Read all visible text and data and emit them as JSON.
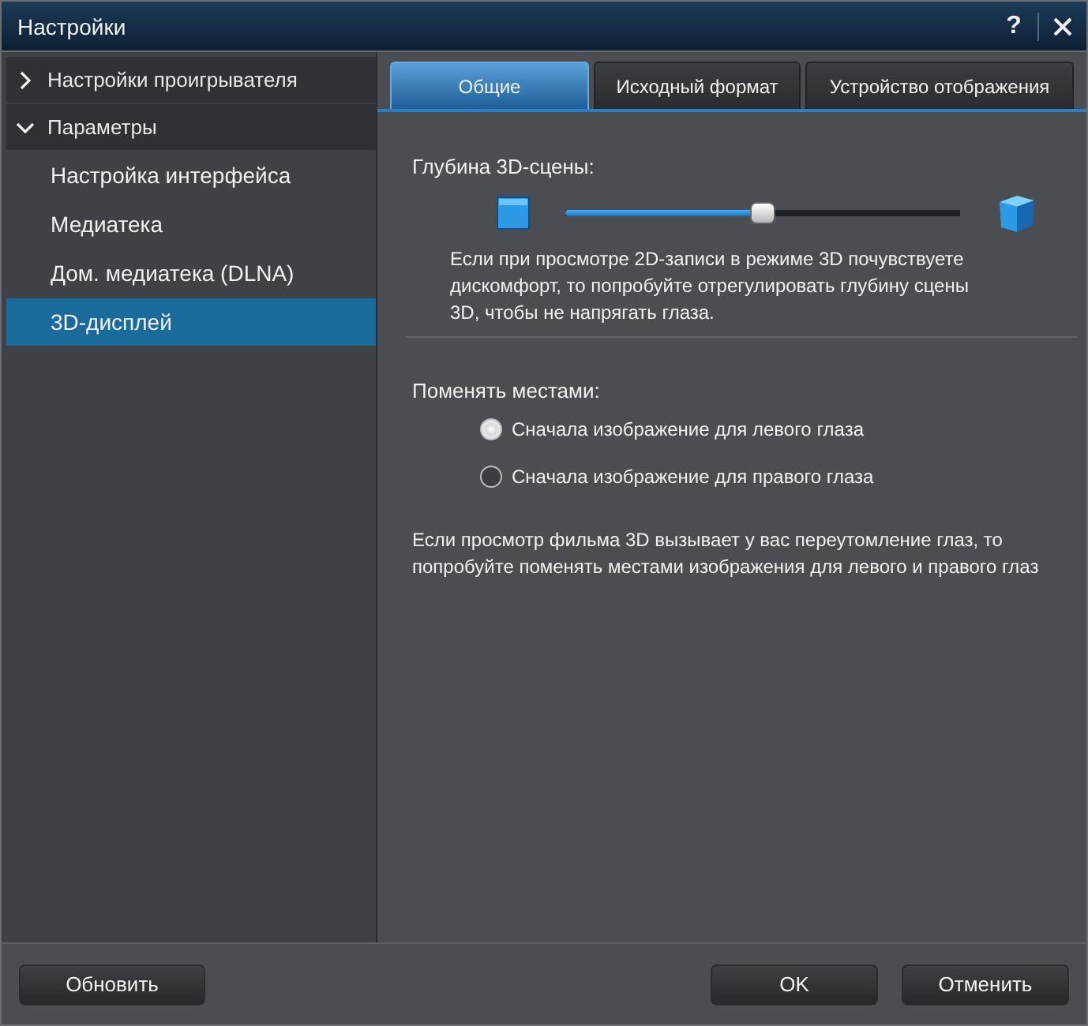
{
  "window": {
    "title": "Настройки",
    "help": "?"
  },
  "sidebar": {
    "groups": [
      {
        "label": "Настройки проигрывателя",
        "expanded": false
      },
      {
        "label": "Параметры",
        "expanded": true,
        "items": [
          {
            "label": "Настройка интерфейса",
            "selected": false
          },
          {
            "label": "Медиатека",
            "selected": false
          },
          {
            "label": "Дом. медиатека (DLNA)",
            "selected": false
          },
          {
            "label": "3D-дисплей",
            "selected": true
          }
        ]
      }
    ]
  },
  "tabs": [
    {
      "label": "Общие",
      "selected": true
    },
    {
      "label": "Исходный формат",
      "selected": false
    },
    {
      "label": "Устройство отображения",
      "selected": false
    }
  ],
  "depth": {
    "label": "Глубина 3D-сцены:",
    "level": 0.5,
    "note": "Если при просмотре 2D-записи в режиме 3D почувствуете дискомфорт, то попробуйте отрегулировать глубину сцены 3D, чтобы не напрягать глаза."
  },
  "swap": {
    "label": "Поменять местами:",
    "options": [
      {
        "label": "Сначала изображение для левого глаза",
        "selected": true
      },
      {
        "label": "Сначала изображение для правого глаза",
        "selected": false
      }
    ],
    "note": "Если просмотр фильма 3D вызывает у вас переутомление глаз, то попробуйте поменять местами изображения для левого и правого глаз"
  },
  "footer": {
    "left": [
      "Обновить"
    ],
    "right": [
      "OK",
      "Отменить"
    ]
  }
}
